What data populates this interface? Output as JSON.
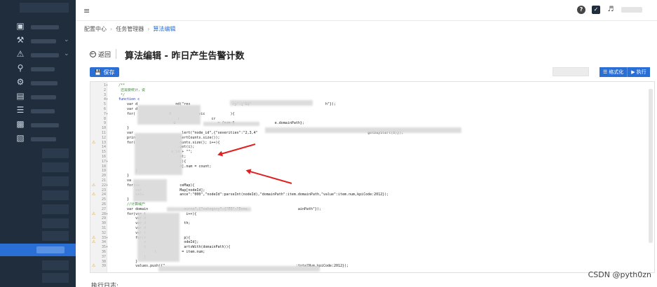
{
  "topbar": {
    "menu_toggle": "≡"
  },
  "breadcrumb": [
    "配置中心",
    "任务管理器",
    "算法编辑"
  ],
  "breadcrumb_sep": "›",
  "page": {
    "back_label": "返回",
    "title": "算法编辑 - 昨日产生告警计数"
  },
  "toolbar": {
    "save_label": "保存",
    "format_label": "格式化",
    "run_label": "执行"
  },
  "editor": {
    "lines": [
      {
        "n": "1",
        "fold": true,
        "warn": false,
        "cls": "c-com",
        "text": "/**"
      },
      {
        "n": "2",
        "fold": false,
        "warn": false,
        "cls": "c-com",
        "text": " 还需要统计，说"
      },
      {
        "n": "3",
        "fold": false,
        "warn": false,
        "cls": "c-com",
        "text": " */"
      },
      {
        "n": "4",
        "fold": true,
        "warn": false,
        "cls": "c-kw",
        "text": "function c"
      },
      {
        "n": "5",
        "fold": false,
        "warn": false,
        "cls": "c-def",
        "text": "    var d                  nd(\"res                    ry\":{\"EQ\"                                   h\"});"
      },
      {
        "n": "6",
        "fold": false,
        "warn": false,
        "cls": "c-def",
        "text": "    var d"
      },
      {
        "n": "7",
        "fold": true,
        "warn": false,
        "cls": "c-def",
        "text": "    for(                0             vic            ){"
      },
      {
        "n": "8",
        "fold": false,
        "warn": false,
        "cls": "c-def",
        "text": "                            c               cr"
      },
      {
        "n": "9",
        "fold": false,
        "warn": false,
        "cls": "c-def",
        "text": "                          d                    = {num:0                   e.domainPath};"
      },
      {
        "n": "10",
        "fold": false,
        "warn": false,
        "cls": "c-def",
        "text": "    }"
      },
      {
        "n": "11",
        "fold": false,
        "warn": false,
        "cls": "c-def",
        "text": "    var                       lert(\"node_id\",{\"severities\":\"2,3,4\"                                                    getDayStart(0)});"
      },
      {
        "n": "12",
        "fold": false,
        "warn": false,
        "cls": "c-def",
        "text": "    prin                     lertCounts.size());"
      },
      {
        "n": "13",
        "fold": false,
        "warn": true,
        "cls": "c-def",
        "text": "    for(                     ounts.size(); i++){"
      },
      {
        "n": "14",
        "fold": false,
        "warn": false,
        "cls": "c-def",
        "text": "                            .get(i);"
      },
      {
        "n": "15",
        "fold": false,
        "warn": false,
        "cls": "c-def",
        "text": "                         e_id + \"\";"
      },
      {
        "n": "16",
        "fold": false,
        "warn": false,
        "cls": "c-def",
        "text": "                             nt;"
      },
      {
        "n": "17",
        "fold": true,
        "warn": false,
        "cls": "c-def",
        "text": "                             ]){"
      },
      {
        "n": "18",
        "fold": false,
        "warn": false,
        "cls": "c-def",
        "text": "                             d].num = count;"
      },
      {
        "n": "19",
        "fold": false,
        "warn": false,
        "cls": "c-def",
        "text": "        }"
      },
      {
        "n": "20",
        "fold": false,
        "warn": false,
        "cls": "c-def",
        "text": "    }"
      },
      {
        "n": "21",
        "fold": false,
        "warn": false,
        "cls": "c-def",
        "text": "    va"
      },
      {
        "n": "22",
        "fold": true,
        "warn": true,
        "cls": "c-def",
        "text": "    for(va                   ceMap){"
      },
      {
        "n": "23",
        "fold": false,
        "warn": false,
        "cls": "c-def",
        "text": "        var                  Map[nodeId];"
      },
      {
        "n": "24",
        "fold": false,
        "warn": true,
        "cls": "c-def",
        "text": "        valu                 ance\":\"000\",\"nodeId\":parseInt(nodeId),\"domainPath\":item.domainPath,\"value\":item.num,kpiCode:2012});"
      },
      {
        "n": "25",
        "fold": false,
        "warn": false,
        "cls": "c-def",
        "text": "    }"
      },
      {
        "n": "26",
        "fold": false,
        "warn": false,
        "cls": "c-com",
        "text": "    //计算域产"
      },
      {
        "n": "27",
        "fold": false,
        "warn": false,
        "cls": "c-def",
        "text": "    var domain                 ource\",{\"category\":{\"EQ\":\"Doma                        ainPath\"});"
      },
      {
        "n": "28",
        "fold": true,
        "warn": true,
        "cls": "c-def",
        "text": "    for(var i                   i++){"
      },
      {
        "n": "29",
        "fold": false,
        "warn": false,
        "cls": "c-def",
        "text": "        var d"
      },
      {
        "n": "30",
        "fold": false,
        "warn": false,
        "cls": "c-def",
        "text": "        var d                  th;"
      },
      {
        "n": "31",
        "fold": false,
        "warn": false,
        "cls": "c-def",
        "text": "        var d"
      },
      {
        "n": "32",
        "fold": false,
        "warn": false,
        "cls": "c-def",
        "text": "        var t"
      },
      {
        "n": "33",
        "fold": true,
        "warn": true,
        "cls": "c-def",
        "text": "        for(v                  p){"
      },
      {
        "n": "34",
        "fold": false,
        "warn": true,
        "cls": "c-def",
        "text": "            v                  odeId];"
      },
      {
        "n": "35",
        "fold": true,
        "warn": false,
        "cls": "c-def",
        "text": "            i                  artsWith(domainPath)){"
      },
      {
        "n": "36",
        "fold": false,
        "warn": false,
        "cls": "c-def",
        "text": "                 t            = item.num;"
      },
      {
        "n": "37",
        "fold": false,
        "warn": false,
        "cls": "c-def",
        "text": "            }"
      },
      {
        "n": "38",
        "fold": false,
        "warn": false,
        "cls": "c-def",
        "text": "        }"
      },
      {
        "n": "39",
        "fold": false,
        "warn": true,
        "cls": "c-def",
        "text": "        values.push({\"                                                              :totalNum,kpiCode:2012});"
      }
    ]
  },
  "log_label": "执行日志:",
  "watermark": "CSDN @pyth0zn",
  "colors": {
    "primary": "#2a6fd6",
    "sidebar": "#1f2d3d",
    "warning": "#e8a317",
    "annotation": "#e02020"
  }
}
